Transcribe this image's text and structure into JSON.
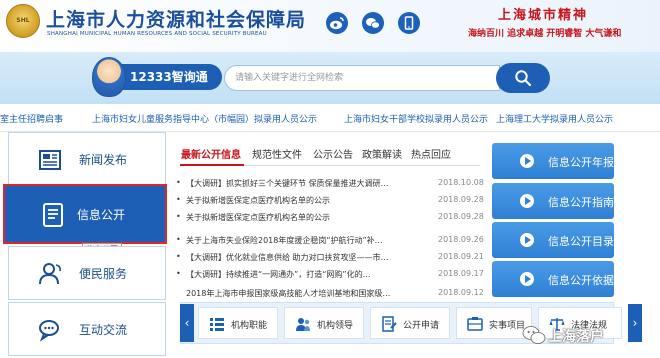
{
  "header": {
    "logo_text": "SHL",
    "bureau_name": "上海市人力资源和社会保障局",
    "bureau_name_en": "SHANGHAI MUNICIPAL HUMAN RESOURCES AND SOCIAL SECURITY BUREAU",
    "spirit_title": "上海城市精神",
    "spirit_words": "海纳百川  追求卓越  开明睿智  大气谦和",
    "social_icons": [
      "weibo-icon",
      "wechat-icon",
      "mobile-icon"
    ]
  },
  "search": {
    "service_name": "12333智询通",
    "placeholder": "请输入关键字进行全网检索"
  },
  "ticker": {
    "items": [
      "室主任招聘启事",
      "上海市妇女儿童服务指导中心（市幅园）拟录用人员公示",
      "上海市妇女干部学校拟录用人员公示",
      "上海理工大学拟录用人员公示"
    ]
  },
  "nav": {
    "items": [
      {
        "label": "新闻发布",
        "icon": "newspaper-icon"
      },
      {
        "label": "信息公开",
        "icon": "document-icon"
      },
      {
        "label": "便民服务",
        "icon": "people-icon"
      },
      {
        "label": "互动交流",
        "icon": "chat-icon"
      }
    ],
    "tooltip": "信息公开"
  },
  "tabs": [
    "最新公开信息",
    "规范性文件",
    "公示公告",
    "政策解读",
    "热点回应"
  ],
  "news": [
    {
      "title": "【大调研】抓实抓好三个关键环节 保质保量推进大调研…",
      "date": "2018.10.08"
    },
    {
      "title": "关于拟新增医保定点医疗机构名单的公示",
      "date": "2018.09.28"
    },
    {
      "title": "关于拟新增医保定点医疗机构名单的公示",
      "date": "2018.09.28"
    },
    {
      "title": "关于上海市失业保险2018年度援企稳岗“护航行动”补…",
      "date": "2018.09.26"
    },
    {
      "title": "【大调研】优化就业信息供给 助力对口扶贫攻坚——市…",
      "date": "2018.09.21"
    },
    {
      "title": "【大调研】持续推进“一网通办”，打造“网购”化的…",
      "date": "2018.09.17"
    },
    {
      "title": "2018年上海市申报国家级高技能人才培训基地和国家级…",
      "date": "2018.09.12"
    }
  ],
  "info_buttons": [
    "信息公开年报",
    "信息公开指南",
    "信息公开目录",
    "信息公开依据"
  ],
  "quick_links": [
    {
      "label": "机构职能",
      "icon": "list-icon"
    },
    {
      "label": "机构领导",
      "icon": "leader-icon"
    },
    {
      "label": "公开申请",
      "icon": "apply-icon"
    },
    {
      "label": "实事项目",
      "icon": "project-icon"
    },
    {
      "label": "法律法规",
      "icon": "law-icon"
    }
  ],
  "arrows": {
    "left": "‹",
    "right": "›"
  },
  "watermark": "上海落户",
  "colors": {
    "brand_blue": "#1d5fb5",
    "accent_red": "#c8151d",
    "button_blue": "#2f80d4"
  }
}
